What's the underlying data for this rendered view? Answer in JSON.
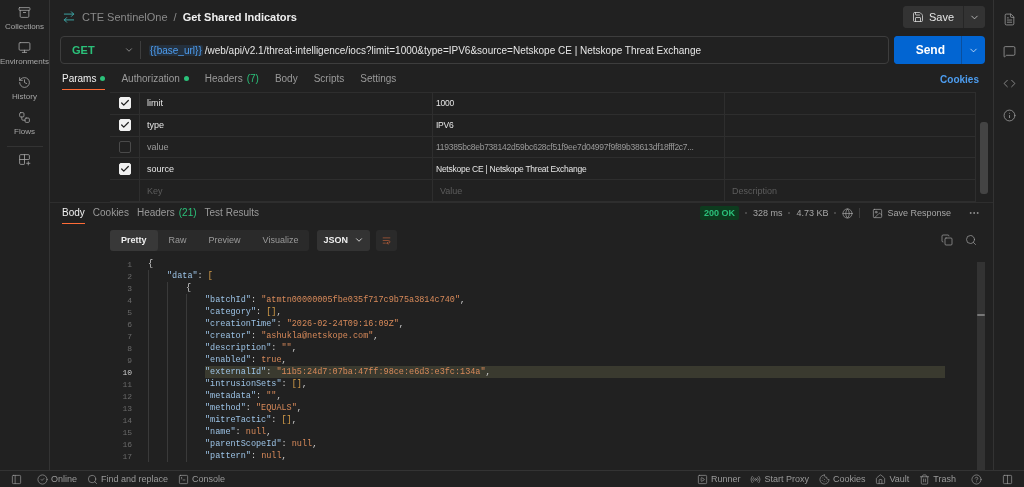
{
  "sidebar": {
    "items": [
      {
        "kind": "collections",
        "label": "Collections"
      },
      {
        "kind": "environments",
        "label": "Environments"
      },
      {
        "kind": "history",
        "label": "History"
      },
      {
        "kind": "flows",
        "label": "Flows"
      },
      {
        "kind": "apps"
      }
    ]
  },
  "header": {
    "breadcrumb": "CTE SentinelOne",
    "separator": "/",
    "title": "Get Shared Indicators",
    "save": "Save"
  },
  "request": {
    "method": "GET",
    "url_variable": "{{base_url}}",
    "url_path": "/web/api/v2.1/threat-intelligence/iocs?limit=1000&type=IPV6&source=Netskope CE | Netskope Threat Exchange",
    "send": "Send"
  },
  "request_tabs": [
    {
      "label": "Params",
      "dot": true,
      "selected": true
    },
    {
      "label": "Authorization",
      "dot": true,
      "selected": false
    },
    {
      "label": "Headers",
      "count": "(7)",
      "dot": false,
      "selected": false
    },
    {
      "label": "Body",
      "dot": false,
      "selected": false
    },
    {
      "label": "Scripts",
      "dot": false,
      "selected": false
    },
    {
      "label": "Settings",
      "dot": false,
      "selected": false
    }
  ],
  "cookies_link": "Cookies",
  "params": {
    "rows": [
      {
        "checked": true,
        "key": "limit",
        "value": "1000"
      },
      {
        "checked": true,
        "key": "type",
        "value": "IPV6"
      },
      {
        "checked": false,
        "key": "value",
        "value": "119385bc8eb738142d59bc628cf51f9ee7d04997f9f89b38613df18fff2c7..."
      },
      {
        "checked": true,
        "key": "source",
        "value": "Netskope CE | Netskope Threat Exchange"
      }
    ],
    "new_row": {
      "key": {
        "placeholder": "Key"
      },
      "value": {
        "placeholder": "Value"
      },
      "description": {
        "placeholder": "Description"
      }
    }
  },
  "response_tabs": [
    {
      "label": "Body",
      "selected": true
    },
    {
      "label": "Cookies",
      "selected": false
    },
    {
      "label": "Headers",
      "count": "(21)",
      "selected": false
    },
    {
      "label": "Test Results",
      "selected": false
    }
  ],
  "response_meta": {
    "status": "200 OK",
    "time": "328 ms",
    "size": "4.73 KB",
    "save": "Save Response"
  },
  "view_tabs": [
    {
      "label": "Pretty",
      "selected": true
    },
    {
      "label": "Raw",
      "selected": false
    },
    {
      "label": "Preview",
      "selected": false
    },
    {
      "label": "Visualize",
      "selected": false
    }
  ],
  "format": "JSON",
  "code": {
    "lines": [
      {
        "num": "1",
        "highlighted": false,
        "tokens": [
          {
            "kind": "punct",
            "text": "{"
          }
        ],
        "children": [
          {
            "num": "2",
            "highlighted": false,
            "tokens": [
              {
                "kind": "key",
                "text": "\"data\""
              },
              {
                "kind": "punct",
                "text": ": "
              },
              {
                "kind": "bracket",
                "text": "["
              }
            ],
            "children": [
              {
                "num": "3",
                "highlighted": false,
                "tokens": [
                  {
                    "kind": "punct",
                    "text": "{"
                  }
                ],
                "children": [
                  {
                    "num": "4",
                    "highlighted": false,
                    "tokens": [
                      {
                        "kind": "key",
                        "text": "\"batchId\""
                      },
                      {
                        "kind": "punct",
                        "text": ": "
                      },
                      {
                        "kind": "string",
                        "text": "\"atmtn00000005fbe035f717c9b75a3814c740\""
                      },
                      {
                        "kind": "punct",
                        "text": ","
                      }
                    ]
                  },
                  {
                    "num": "5",
                    "highlighted": false,
                    "tokens": [
                      {
                        "kind": "key",
                        "text": "\"category\""
                      },
                      {
                        "kind": "punct",
                        "text": ": "
                      },
                      {
                        "kind": "bracket",
                        "text": "[]"
                      },
                      {
                        "kind": "punct",
                        "text": ","
                      }
                    ]
                  },
                  {
                    "num": "6",
                    "highlighted": false,
                    "tokens": [
                      {
                        "kind": "key",
                        "text": "\"creationTime\""
                      },
                      {
                        "kind": "punct",
                        "text": ": "
                      },
                      {
                        "kind": "string",
                        "text": "\"2026-02-24T09:16:09Z\""
                      },
                      {
                        "kind": "punct",
                        "text": ","
                      }
                    ]
                  },
                  {
                    "num": "7",
                    "highlighted": false,
                    "tokens": [
                      {
                        "kind": "key",
                        "text": "\"creator\""
                      },
                      {
                        "kind": "punct",
                        "text": ": "
                      },
                      {
                        "kind": "string",
                        "text": "\"ashukla@netskope.com\""
                      },
                      {
                        "kind": "punct",
                        "text": ","
                      }
                    ]
                  },
                  {
                    "num": "8",
                    "highlighted": false,
                    "tokens": [
                      {
                        "kind": "key",
                        "text": "\"description\""
                      },
                      {
                        "kind": "punct",
                        "text": ": "
                      },
                      {
                        "kind": "string",
                        "text": "\"\""
                      },
                      {
                        "kind": "punct",
                        "text": ","
                      }
                    ]
                  },
                  {
                    "num": "9",
                    "highlighted": false,
                    "tokens": [
                      {
                        "kind": "key",
                        "text": "\"enabled\""
                      },
                      {
                        "kind": "punct",
                        "text": ": "
                      },
                      {
                        "kind": "literal",
                        "text": "true"
                      },
                      {
                        "kind": "punct",
                        "text": ","
                      }
                    ]
                  },
                  {
                    "num": "10",
                    "highlighted": true,
                    "tokens": [
                      {
                        "kind": "key",
                        "text": "\"externalId\""
                      },
                      {
                        "kind": "punct",
                        "text": ": "
                      },
                      {
                        "kind": "string",
                        "text": "\"11b5:24d7:07ba:47ff:98ce:e6d3:e3fc:134a\""
                      },
                      {
                        "kind": "punct",
                        "text": ","
                      }
                    ]
                  },
                  {
                    "num": "11",
                    "highlighted": false,
                    "tokens": [
                      {
                        "kind": "key",
                        "text": "\"intrusionSets\""
                      },
                      {
                        "kind": "punct",
                        "text": ": "
                      },
                      {
                        "kind": "bracket",
                        "text": "[]"
                      },
                      {
                        "kind": "punct",
                        "text": ","
                      }
                    ]
                  },
                  {
                    "num": "12",
                    "highlighted": false,
                    "tokens": [
                      {
                        "kind": "key",
                        "text": "\"metadata\""
                      },
                      {
                        "kind": "punct",
                        "text": ": "
                      },
                      {
                        "kind": "string",
                        "text": "\"\""
                      },
                      {
                        "kind": "punct",
                        "text": ","
                      }
                    ]
                  },
                  {
                    "num": "13",
                    "highlighted": false,
                    "tokens": [
                      {
                        "kind": "key",
                        "text": "\"method\""
                      },
                      {
                        "kind": "punct",
                        "text": ": "
                      },
                      {
                        "kind": "string",
                        "text": "\"EQUALS\""
                      },
                      {
                        "kind": "punct",
                        "text": ","
                      }
                    ]
                  },
                  {
                    "num": "14",
                    "highlighted": false,
                    "tokens": [
                      {
                        "kind": "key",
                        "text": "\"mitreTactic\""
                      },
                      {
                        "kind": "punct",
                        "text": ": "
                      },
                      {
                        "kind": "bracket",
                        "text": "[]"
                      },
                      {
                        "kind": "punct",
                        "text": ","
                      }
                    ]
                  },
                  {
                    "num": "15",
                    "highlighted": false,
                    "tokens": [
                      {
                        "kind": "key",
                        "text": "\"name\""
                      },
                      {
                        "kind": "punct",
                        "text": ": "
                      },
                      {
                        "kind": "literal",
                        "text": "null"
                      },
                      {
                        "kind": "punct",
                        "text": ","
                      }
                    ]
                  },
                  {
                    "num": "16",
                    "highlighted": false,
                    "tokens": [
                      {
                        "kind": "key",
                        "text": "\"parentScopeId\""
                      },
                      {
                        "kind": "punct",
                        "text": ": "
                      },
                      {
                        "kind": "literal",
                        "text": "null"
                      },
                      {
                        "kind": "punct",
                        "text": ","
                      }
                    ]
                  },
                  {
                    "num": "17",
                    "highlighted": false,
                    "tokens": [
                      {
                        "kind": "key",
                        "text": "\"pattern\""
                      },
                      {
                        "kind": "punct",
                        "text": ": "
                      },
                      {
                        "kind": "literal",
                        "text": "null"
                      },
                      {
                        "kind": "punct",
                        "text": ","
                      }
                    ]
                  }
                ]
              }
            ]
          }
        ]
      }
    ]
  },
  "status_bar": {
    "left": [
      {
        "kind": "sidebar"
      },
      {
        "kind": "online",
        "label": "Online"
      },
      {
        "kind": "find",
        "label": "Find and replace"
      },
      {
        "kind": "console",
        "label": "Console"
      }
    ],
    "right": [
      {
        "kind": "runner",
        "label": "Runner"
      },
      {
        "kind": "proxy",
        "label": "Start Proxy"
      },
      {
        "kind": "cookies",
        "label": "Cookies"
      },
      {
        "kind": "vault",
        "label": "Vault"
      },
      {
        "kind": "trash",
        "label": "Trash"
      },
      {
        "kind": "help"
      },
      {
        "kind": "layout"
      }
    ]
  }
}
